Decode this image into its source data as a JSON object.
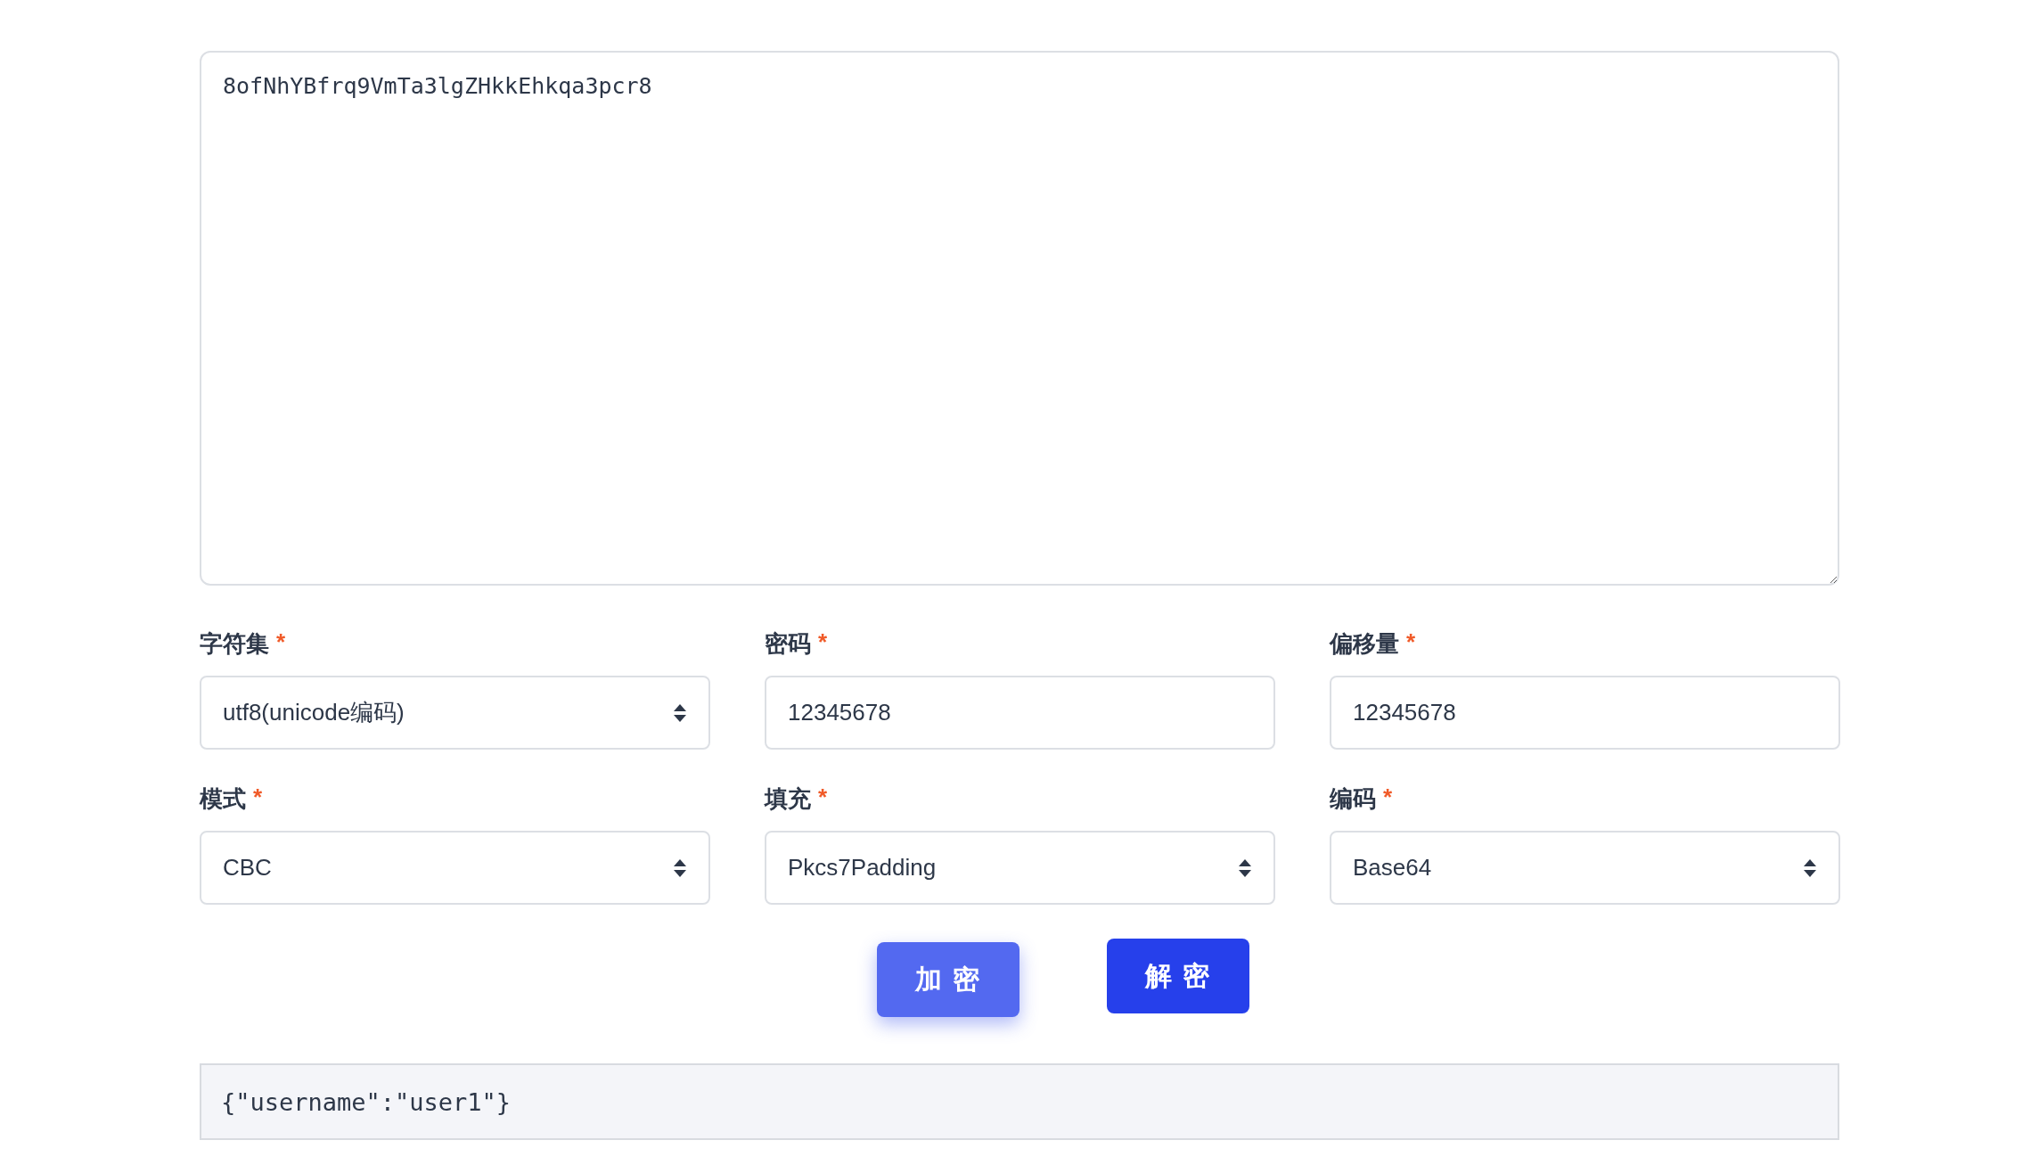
{
  "cipher_text": {
    "value": "8ofNhYBfrq9VmTa3lgZHkkEhkqa3pcr8"
  },
  "fields": [
    {
      "label": "字符集",
      "required": true,
      "kind": "select",
      "value": "utf8(unicode编码)"
    },
    {
      "label": "密码",
      "required": true,
      "kind": "input",
      "value": "12345678"
    },
    {
      "label": "偏移量",
      "required": true,
      "kind": "input",
      "value": "12345678"
    },
    {
      "label": "模式",
      "required": true,
      "kind": "select",
      "value": "CBC"
    },
    {
      "label": "填充",
      "required": true,
      "kind": "select",
      "value": "Pkcs7Padding"
    },
    {
      "label": "编码",
      "required": true,
      "kind": "select",
      "value": "Base64"
    }
  ],
  "required_mark": "*",
  "buttons": [
    {
      "label": "加 密",
      "highlighted": true
    },
    {
      "label": "解 密",
      "highlighted": false
    }
  ],
  "output": {
    "text": "{\"username\":\"user1\"}"
  }
}
